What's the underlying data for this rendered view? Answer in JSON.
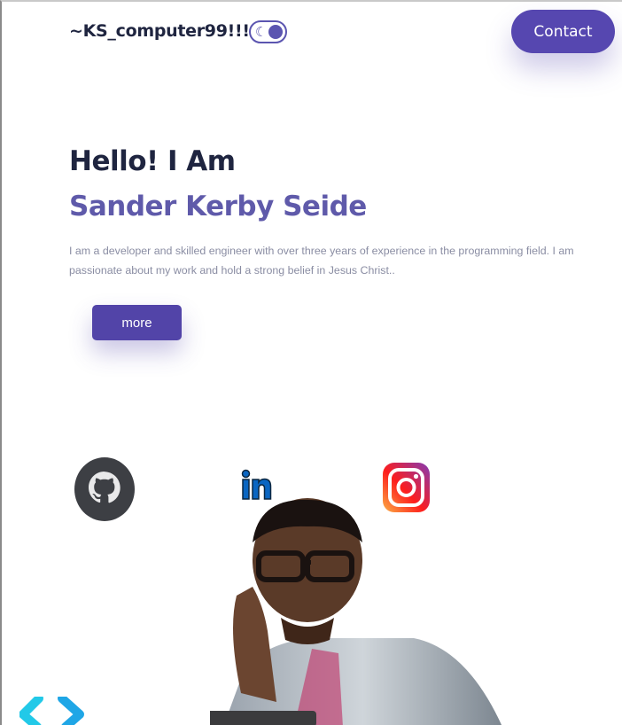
{
  "header": {
    "brand": "~KS_computer99!!!",
    "contact_label": "Contact"
  },
  "hero": {
    "greeting": "Hello! I Am",
    "name": "Sander Kerby Seide",
    "bio": "I am a developer and skilled engineer with over three years of experience in the programming field. I am passionate about my work and hold a strong belief in Jesus Christ..",
    "more_label": "more"
  },
  "social": {
    "linkedin_text": "in"
  },
  "icons": [
    "moon-icon",
    "github-icon",
    "linkedin-icon",
    "instagram-icon",
    "code-brackets-icon"
  ],
  "colors": {
    "accent": "#5647b0",
    "name": "#5f5aaa",
    "heading": "#1f2540",
    "body_text": "#8a8da3"
  }
}
